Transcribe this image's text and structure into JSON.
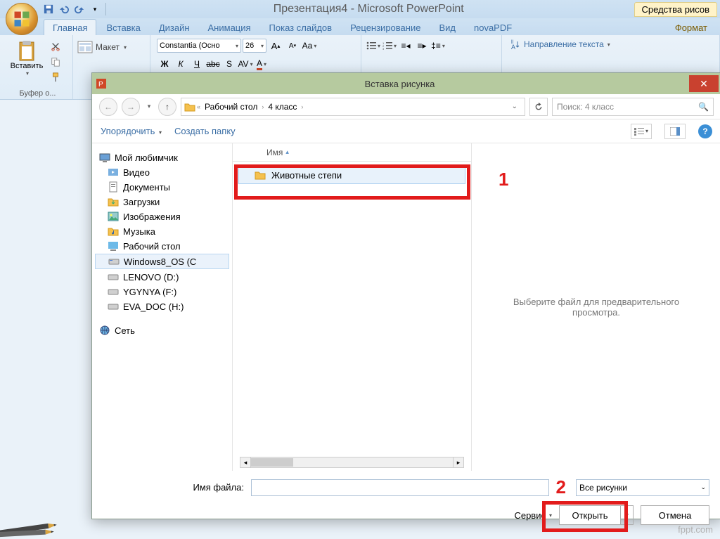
{
  "app": {
    "title": "Презентация4 - Microsoft PowerPoint",
    "tools_tab": "Средства рисов"
  },
  "ribbon": {
    "tabs": [
      "Главная",
      "Вставка",
      "Дизайн",
      "Анимация",
      "Показ слайдов",
      "Рецензирование",
      "Вид",
      "novaPDF"
    ],
    "tools_format": "Формат",
    "paste": "Вставить",
    "clipboard_group": "Буфер о...",
    "layout": "Макет",
    "font_name": "Constantia (Осно",
    "font_size": "26",
    "text_direction": "Направление текста"
  },
  "dialog": {
    "title": "Вставка рисунка",
    "breadcrumbs": [
      "Рабочий стол",
      "4 класс"
    ],
    "search_placeholder": "Поиск: 4 класс",
    "organize": "Упорядочить",
    "new_folder": "Создать папку",
    "col_name": "Имя",
    "tree": {
      "header": "Мой любимчик",
      "items": [
        "Видео",
        "Документы",
        "Загрузки",
        "Изображения",
        "Музыка",
        "Рабочий стол",
        "Windows8_OS (C",
        "LENOVO (D:)",
        "YGYNYA (F:)",
        "EVA_DOC (H:)"
      ],
      "network": "Сеть"
    },
    "file_item": "Животные степи",
    "preview_text": "Выберите файл для предварительного просмотра.",
    "filename_label": "Имя файла:",
    "filter": "Все рисунки",
    "service": "Сервис",
    "open": "Открыть",
    "cancel": "Отмена"
  },
  "annotations": {
    "one": "1",
    "two": "2"
  },
  "watermark": "fppt.com"
}
